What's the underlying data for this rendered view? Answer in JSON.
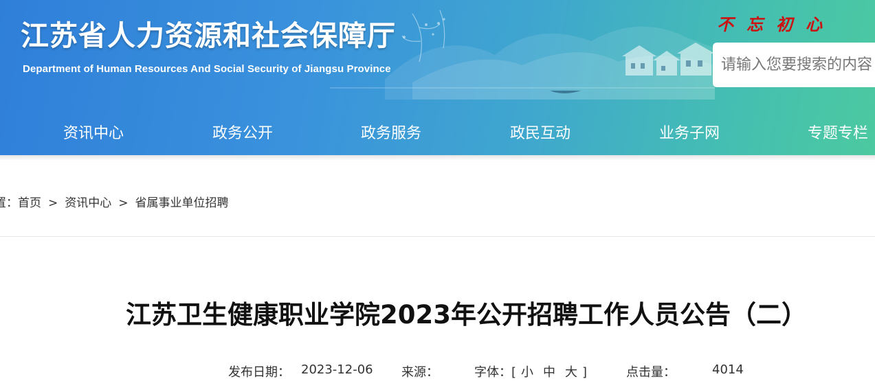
{
  "header": {
    "site_title": "江苏省人力资源和社会保障厅",
    "site_subtitle": "Department of Human Resources And Social Security of Jiangsu Province",
    "slogan": "不忘初心",
    "search_placeholder": "请输入您要搜索的内容",
    "colors": {
      "banner_start": "#2f7fd9",
      "banner_end": "#4cc9a0",
      "slogan": "#cc1111"
    }
  },
  "nav": {
    "items": [
      {
        "label": "资讯中心"
      },
      {
        "label": "政务公开"
      },
      {
        "label": "政务服务"
      },
      {
        "label": "政民互动"
      },
      {
        "label": "业务子网"
      },
      {
        "label": "专题专栏"
      }
    ]
  },
  "breadcrumb": {
    "prefix": "置：",
    "items": [
      {
        "label": "首页"
      },
      {
        "label": "资讯中心"
      },
      {
        "label": "省属事业单位招聘"
      }
    ],
    "separator": ">"
  },
  "article": {
    "title": "江苏卫生健康职业学院2023年公开招聘工作人员公告（二）",
    "meta": {
      "date_label": "发布日期：",
      "date_value": "2023-12-06",
      "source_label": "来源：",
      "source_value": "",
      "font_label": "字体：",
      "font_open": "[",
      "font_small": "小",
      "font_medium": "中",
      "font_large": "大",
      "font_close": "]",
      "hits_label": "点击量：",
      "hits_value": "4014"
    }
  }
}
